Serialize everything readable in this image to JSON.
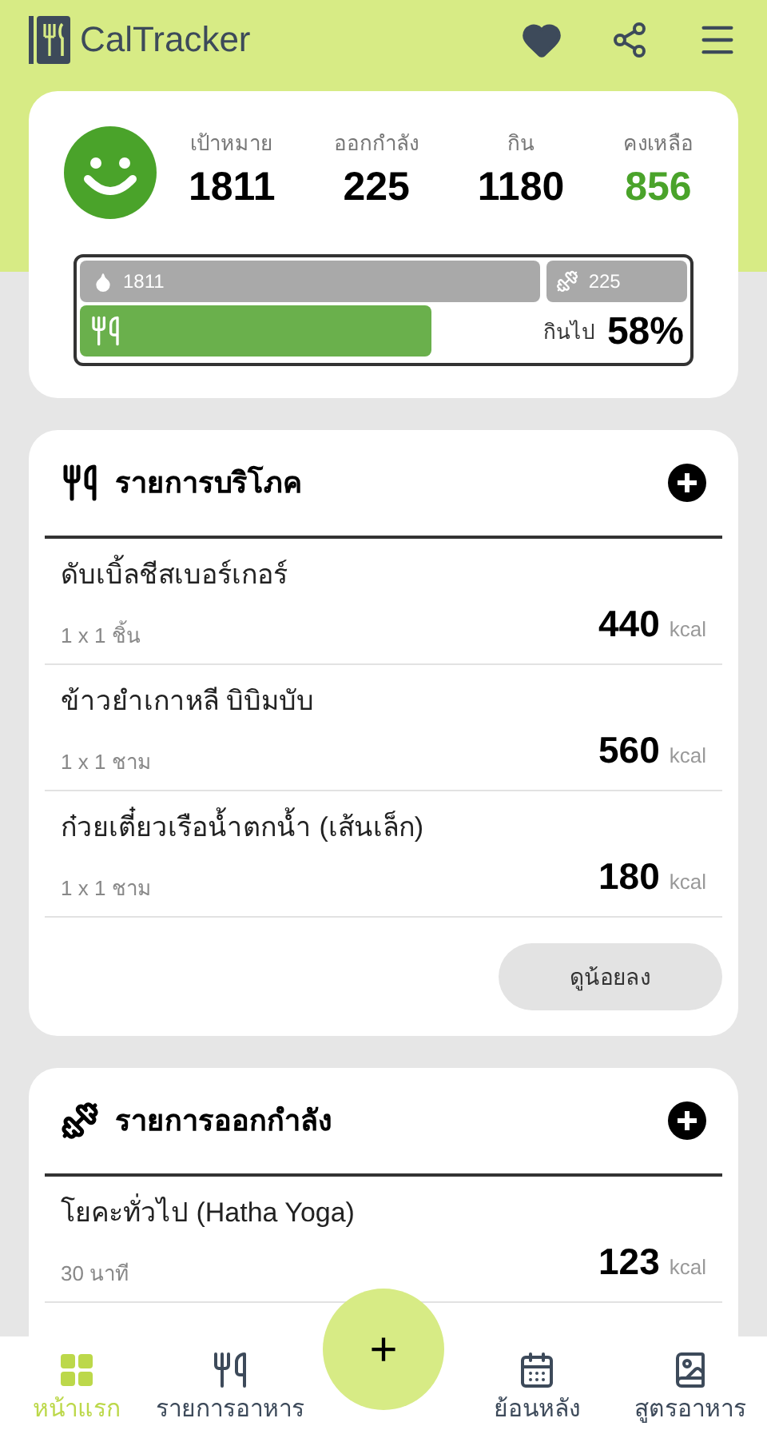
{
  "app": {
    "title": "CalTracker"
  },
  "summary": {
    "stats": [
      {
        "label": "เป้าหมาย",
        "value": "1811",
        "kind": "plain"
      },
      {
        "label": "ออกกำลัง",
        "value": "225",
        "kind": "plain"
      },
      {
        "label": "กิน",
        "value": "1180",
        "kind": "plain"
      },
      {
        "label": "คงเหลือ",
        "value": "856",
        "kind": "highlight"
      }
    ],
    "goal_bar": {
      "goal": "1811",
      "exercise": "225"
    },
    "eaten": {
      "label": "กินไป",
      "percent": "58%",
      "level": 0.58
    }
  },
  "food": {
    "title": "รายการบริโภค",
    "items": [
      {
        "name": "ดับเบิ้ลชีสเบอร์เกอร์",
        "amount": "1 x 1 ชิ้น",
        "calories": "440",
        "unit": "kcal"
      },
      {
        "name": "ข้าวยำเกาหลี บิบิมบับ",
        "amount": "1 x 1 ชาม",
        "calories": "560",
        "unit": "kcal"
      },
      {
        "name": "ก๋วยเตี๋ยวเรือน้ำตกน้ำ (เส้นเล็ก)",
        "amount": "1 x 1 ชาม",
        "calories": "180",
        "unit": "kcal"
      }
    ],
    "toggle": "ดูน้อยลง"
  },
  "exercise": {
    "title": "รายการออกกำลัง",
    "items": [
      {
        "name": "โยคะทั่วไป (Hatha Yoga)",
        "amount": "30 นาที",
        "calories": "123",
        "unit": "kcal"
      }
    ]
  },
  "fab": "+",
  "nav": [
    {
      "label": "หน้าแรก",
      "kind": "home",
      "selected": true
    },
    {
      "label": "รายการอาหาร",
      "kind": "food",
      "selected": false
    },
    {
      "label": "ย้อนหลัง",
      "kind": "history",
      "selected": false
    },
    {
      "label": "สูตรอาหาร",
      "kind": "recipes",
      "selected": false
    }
  ]
}
